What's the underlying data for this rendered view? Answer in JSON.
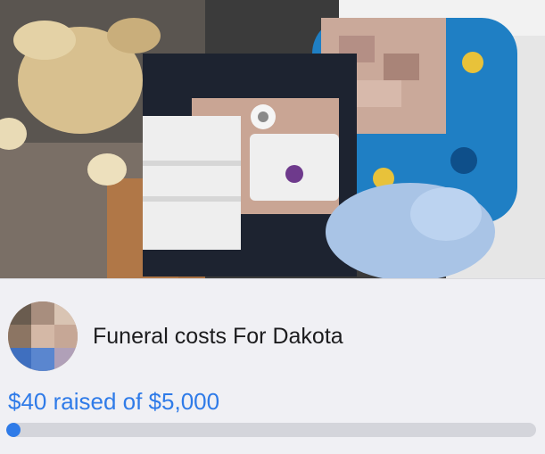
{
  "fundraiser": {
    "title": "Funeral costs For Dakota",
    "amount_text": "$40 raised of $5,000",
    "raised": 40,
    "goal": 5000,
    "progress_fraction": 0.008
  },
  "colors": {
    "accent": "#2f7be8",
    "track": "#d4d5db",
    "background": "#f0f0f4",
    "title_text": "#1c1c1e"
  }
}
